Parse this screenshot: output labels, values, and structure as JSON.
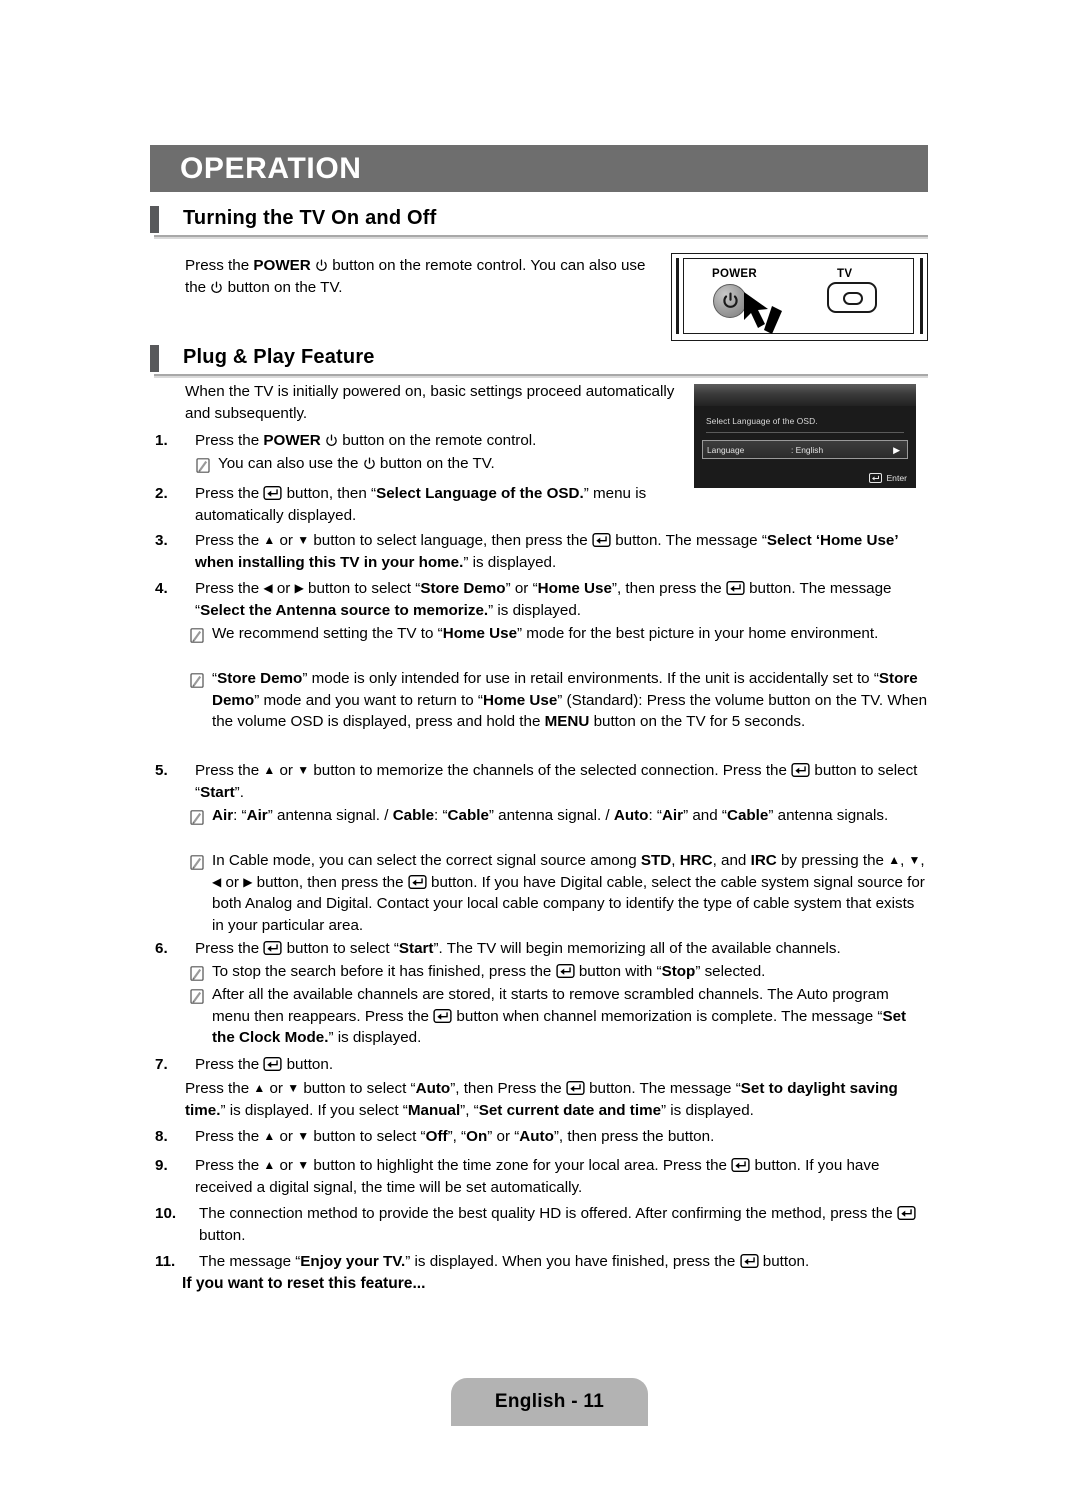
{
  "banner": {
    "title": "OPERATION"
  },
  "sections": [
    {
      "title": "Turning the TV On and Off"
    },
    {
      "title": "Plug & Play Feature"
    }
  ],
  "turning_on": {
    "paragraph_1": "Press the ",
    "power_word": "POWER",
    "paragraph_2": " button on the remote control. You can also use the ",
    "paragraph_3": " button on the TV."
  },
  "remote_figure": {
    "power_label": "POWER",
    "tv_label": "TV"
  },
  "osd_figure": {
    "prompt": "Select Language of the OSD.",
    "row_label": "Language",
    "row_value": ": English",
    "row_arrow": "▶",
    "enter_label": "Enter"
  },
  "plug_play": {
    "intro": "When the TV is initially powered on, basic settings proceed automatically and subsequently.",
    "steps": [
      {
        "num": "1.",
        "text_parts": [
          {
            "t": "Press the ",
            "b": false
          },
          {
            "t": "POWER",
            "b": true
          },
          {
            "t": " [power] button on the remote control.",
            "b": false
          }
        ],
        "plain": "Press the POWER button on the remote control."
      },
      {
        "num": "2.",
        "plain": "Press the [enter] button, then “Select Language of the OSD.” menu is automatically displayed."
      },
      {
        "num": "3.",
        "plain": "Press the ▲ or ▼ button to select language, then press the [enter] button. The message “Select ‘Home Use’ when installing this TV in your home.” is displayed."
      },
      {
        "num": "4.",
        "plain": "Press the ◀ or ▶ button to select “Store Demo” or “Home Use”, then press the [enter] button. The message “Select the Antenna source to memorize.” is displayed."
      },
      {
        "num": "5.",
        "plain": "Press the ▲ or ▼ button to memorize the channels of the selected connection. Press the [enter] button to select “Start”."
      },
      {
        "num": "6.",
        "plain": "Press the [enter] button to select “Start”. The TV will begin memorizing all of the available channels."
      },
      {
        "num": "7.",
        "plain": "Press the [enter] button."
      },
      {
        "num": "8.",
        "plain": "Press the ▲ or ▼ button to select “Off”, “On” or “Auto”, then press the  button."
      },
      {
        "num": "9.",
        "plain": "Press the ▲ or ▼ button to highlight the time zone for your local area. Press the [enter] button. If you have received a digital signal, the time will be set automatically."
      },
      {
        "num": "10.",
        "plain": "The connection method to provide the best quality HD is offered. After confirming the method, press the [enter] button."
      },
      {
        "num": "11.",
        "plain": "The message “Enjoy your TV.” is displayed. When you have finished, press the [enter] button."
      }
    ],
    "notes": [
      "You can also use the [power] button on the TV.",
      "We recommend setting the TV to “Home Use” mode for the best picture in your home environment.",
      "“Store Demo” mode is only intended for use in retail environments. If the unit is accidentally set to “Store Demo” mode and you want to return to “Home Use” (Standard): Press the volume button on the TV. When the volume OSD is displayed, press and hold the MENU button on the TV for 5 seconds.",
      "Air: “Air” antenna signal. / Cable: “Cable” antenna signal. / Auto: “Air” and “Cable” antenna signals.",
      "In Cable mode, you can select the correct signal source among STD, HRC, and IRC by pressing the ▲, ▼, ◀ or ▶ button, then press the [enter] button. If you have Digital cable, select the cable system signal source for both Analog and Digital. Contact your local cable company to identify the type of cable system that exists in your particular area.",
      "To stop the search before it has finished, press the [enter] button with “Stop” selected.",
      "After all the available channels are stored, it starts to remove scrambled channels. The Auto program menu then reappears. Press the [enter] button when channel memorization is complete. The message “Set the Clock Mode.” is displayed."
    ],
    "step7_continuation": "Press the ▲ or ▼ button to select “Auto”, then Press the [enter] button. The message “Set to daylight saving time.” is displayed. If you select “Manual”, “Set current date and time” is displayed.",
    "reset_note": "If you want to reset this feature..."
  },
  "footer": {
    "label": "English - 11"
  },
  "colors": {
    "banner_bg": "#6e6e6e",
    "section_bar": "#58595b",
    "footer_bg": "#b3b3b3",
    "text": "#000000"
  }
}
